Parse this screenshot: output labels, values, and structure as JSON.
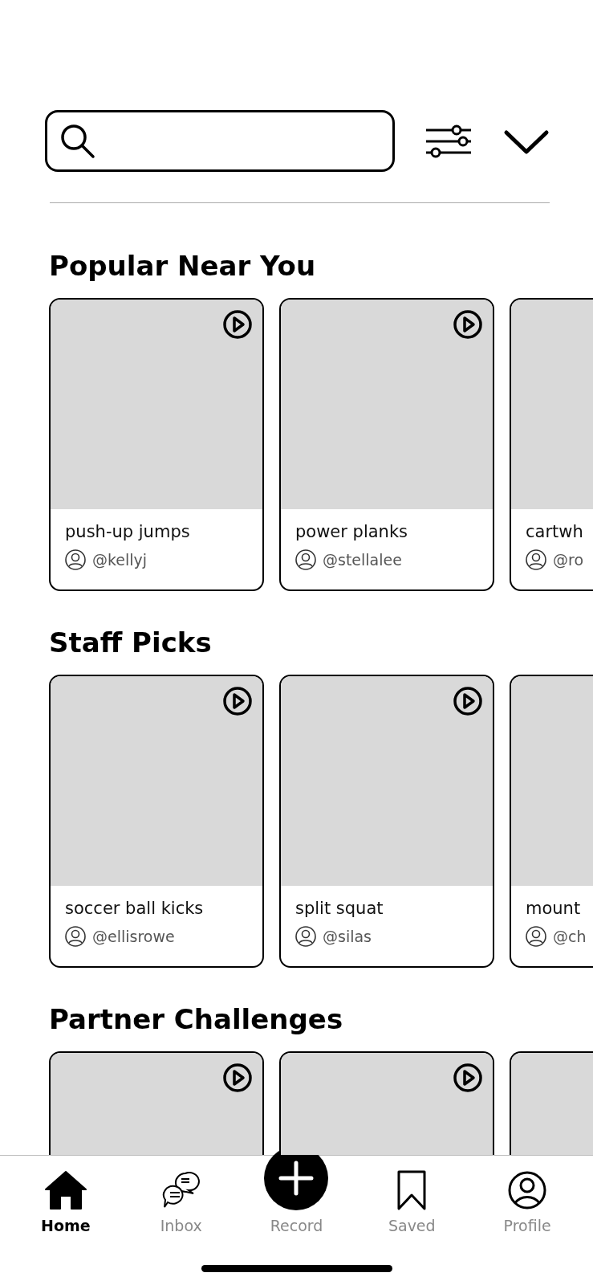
{
  "sections": [
    {
      "title": "Popular Near You",
      "cards": [
        {
          "kind": "full",
          "title": "push-up jumps",
          "handle": "@kellyj"
        },
        {
          "kind": "full",
          "title": "power planks",
          "handle": "@stellalee"
        },
        {
          "kind": "partial",
          "title": "cartwh",
          "handle": "@ro"
        }
      ]
    },
    {
      "title": "Staff Picks",
      "cards": [
        {
          "kind": "full",
          "title": "soccer ball kicks",
          "handle": "@ellisrowe"
        },
        {
          "kind": "full",
          "title": "split squat",
          "handle": "@silas"
        },
        {
          "kind": "partial",
          "title": "mount",
          "handle": "@ch"
        }
      ]
    },
    {
      "title": "Partner Challenges",
      "cards": [
        {
          "kind": "full"
        },
        {
          "kind": "full"
        },
        {
          "kind": "partial"
        }
      ]
    }
  ],
  "nav": [
    {
      "kind": "home",
      "label": "Home",
      "selected": true
    },
    {
      "kind": "inbox",
      "label": "Inbox",
      "selected": false
    },
    {
      "kind": "record",
      "label": "Record",
      "selected": false
    },
    {
      "kind": "saved",
      "label": "Saved",
      "selected": false
    },
    {
      "kind": "profile",
      "label": "Profile",
      "selected": false
    }
  ]
}
